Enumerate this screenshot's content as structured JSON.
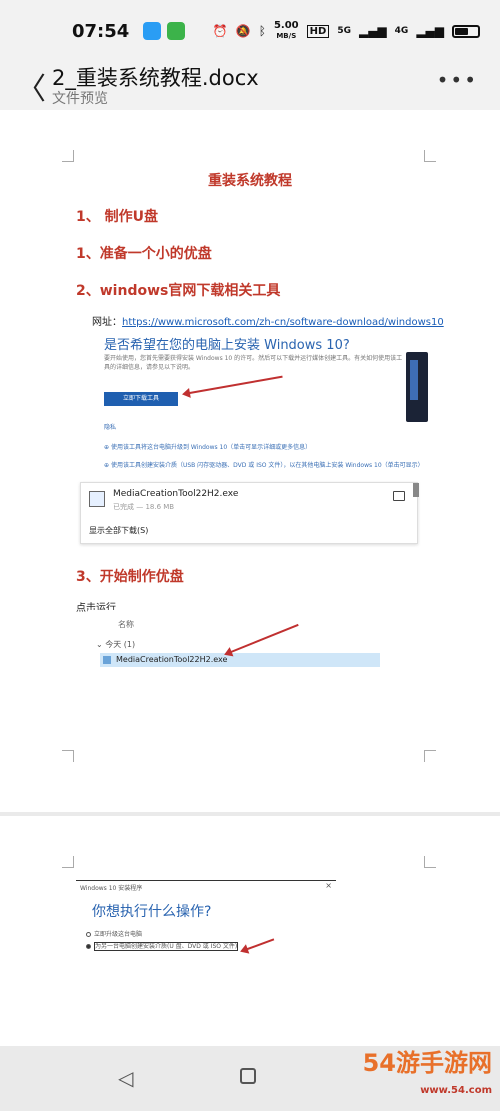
{
  "status_bar": {
    "time": "07:54",
    "network_speed": "5.00",
    "speed_unit": "MB/S",
    "hd_label": "HD",
    "signal1": "5G",
    "signal2": "4G",
    "icons": [
      "paper-plane-icon",
      "chat-app-icon",
      "alarm-icon",
      "mute-icon",
      "bluetooth-icon",
      "battery-icon"
    ]
  },
  "header": {
    "title": "2_重装系统教程.docx",
    "subtitle": "文件预览",
    "back_glyph": "〈",
    "more_glyph": "•••"
  },
  "document": {
    "title": "重装系统教程",
    "headings": {
      "h1": "1、 制作U盘",
      "h2": "1、准备一个小的优盘",
      "h3": "2、windows官网下载相关工具",
      "h4": "3、开始制作优盘"
    },
    "url_label": "网址：",
    "url": "https://www.microsoft.com/zh-cn/software-download/windows10",
    "ms_page": {
      "question": "是否希望在您的电脑上安装 Windows 10?",
      "desc": "要开始使用，您首先需要获得安装 Windows 10 的许可。然后可以下载并运行媒体创建工具。有关如何使用该工具的详细信息，请参见以下说明。",
      "download_button": "立即下载工具",
      "privacy": "隐私",
      "row1": "使用该工具将这台电脑升级到 Windows 10（单击可显示详细或更多信息）",
      "row2": "使用该工具创建安装介质（USB 闪存驱动器、DVD 或 ISO 文件），以在其他电脑上安装 Windows 10（单击可显示）"
    },
    "download_panel": {
      "file_name": "MediaCreationTool22H2.exe",
      "file_meta": "已完成 — 18.6 MB",
      "show_all": "显示全部下载(S)"
    },
    "run_label": "点击运行",
    "explorer": {
      "column": "名称",
      "group": "今天 (1)",
      "selected_file": "MediaCreationTool22H2.exe"
    },
    "setup_window": {
      "title_bar": "Windows 10 安装程序",
      "close": "×",
      "question": "你想执行什么操作?",
      "option1": "立即升级这台电脑",
      "option2": "为另一台电脑创建安装介质(U 盘、DVD 或 ISO 文件)"
    }
  },
  "nav": {
    "back_glyph": "◁"
  },
  "watermark": {
    "main": "54游手游网",
    "sub": "www.54.com"
  },
  "colors": {
    "accent_red": "#c0392b",
    "link_blue": "#1b5eb8",
    "ms_blue": "#1f5fb0"
  }
}
